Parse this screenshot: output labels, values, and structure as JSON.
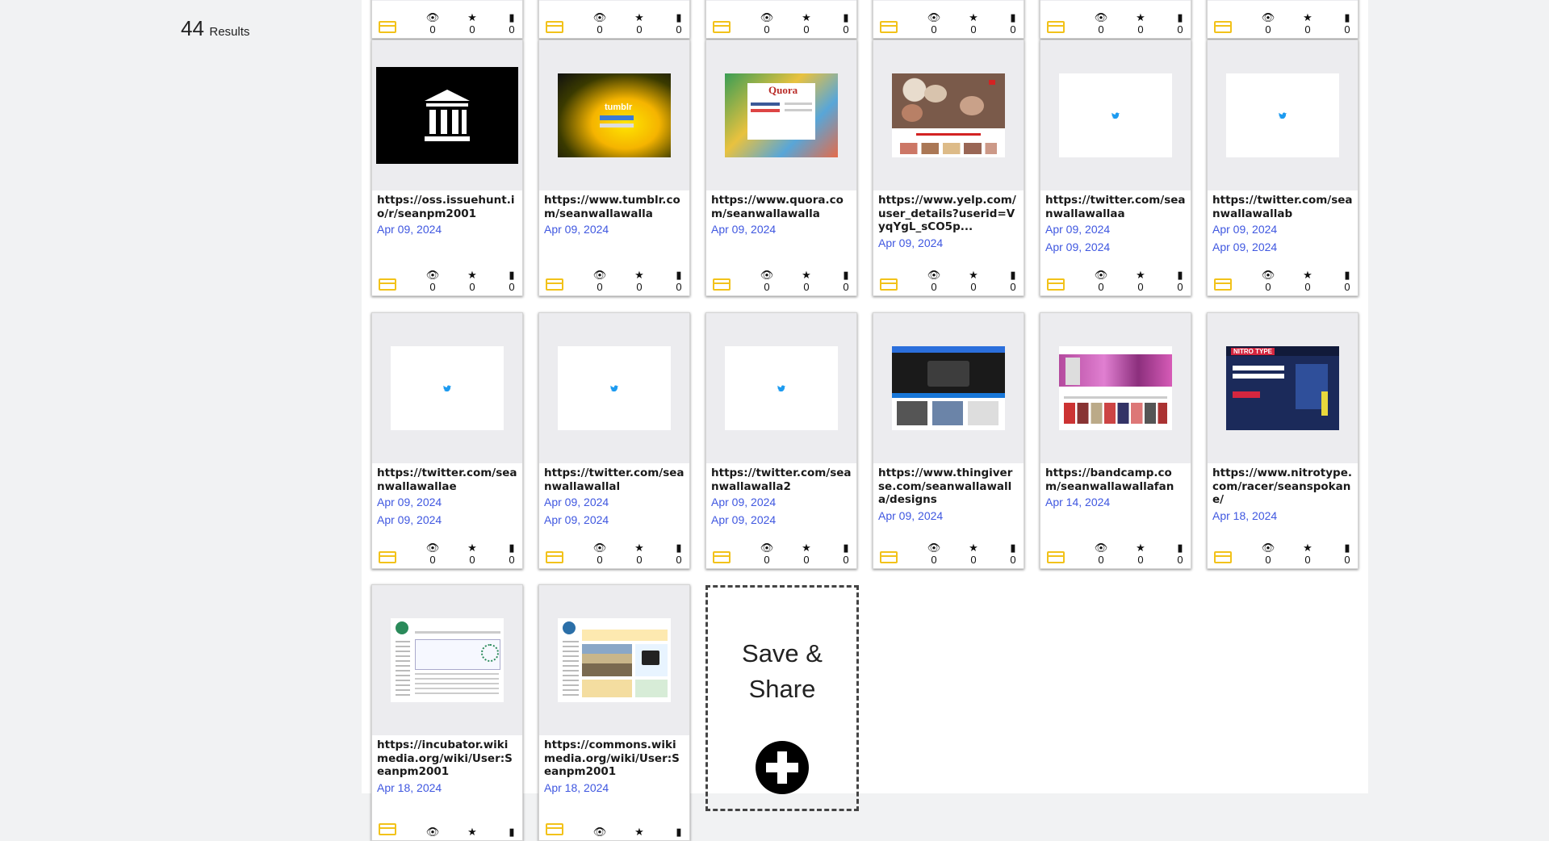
{
  "results": {
    "count": "44",
    "label": "Results"
  },
  "cards": [
    {
      "url": "",
      "dates": [],
      "views": "0",
      "stars": "0",
      "comments": "0",
      "thumb": "none"
    },
    {
      "url": "",
      "dates": [],
      "views": "0",
      "stars": "0",
      "comments": "0",
      "thumb": "none"
    },
    {
      "url": "",
      "dates": [],
      "views": "0",
      "stars": "0",
      "comments": "0",
      "thumb": "none"
    },
    {
      "url": "",
      "dates": [],
      "views": "0",
      "stars": "0",
      "comments": "0",
      "thumb": "none"
    },
    {
      "url": "",
      "dates": [],
      "views": "0",
      "stars": "0",
      "comments": "0",
      "thumb": "none"
    },
    {
      "url": "",
      "dates": [],
      "views": "0",
      "stars": "0",
      "comments": "0",
      "thumb": "none"
    },
    {
      "url": "https://oss.issuehunt.io/r/seanpm2001",
      "dates": [
        "Apr 09, 2024"
      ],
      "views": "0",
      "stars": "0",
      "comments": "0",
      "thumb": "archive"
    },
    {
      "url": "https://www.tumblr.com/seanwallawalla",
      "dates": [
        "Apr 09, 2024"
      ],
      "views": "0",
      "stars": "0",
      "comments": "0",
      "thumb": "tumblr"
    },
    {
      "url": "https://www.quora.com/seanwallawalla",
      "dates": [
        "Apr 09, 2024"
      ],
      "views": "0",
      "stars": "0",
      "comments": "0",
      "thumb": "quora"
    },
    {
      "url": "https://www.yelp.com/user_details?userid=VyqYgL_sCO5p...",
      "dates": [
        "Apr 09, 2024"
      ],
      "views": "0",
      "stars": "0",
      "comments": "0",
      "thumb": "yelp"
    },
    {
      "url": "https://twitter.com/seanwallawallaa",
      "dates": [
        "Apr 09, 2024",
        "Apr 09, 2024"
      ],
      "views": "0",
      "stars": "0",
      "comments": "0",
      "thumb": "twitter"
    },
    {
      "url": "https://twitter.com/seanwallawallab",
      "dates": [
        "Apr 09, 2024",
        "Apr 09, 2024"
      ],
      "views": "0",
      "stars": "0",
      "comments": "0",
      "thumb": "twitter"
    },
    {
      "url": "https://twitter.com/seanwallawallae",
      "dates": [
        "Apr 09, 2024",
        "Apr 09, 2024"
      ],
      "views": "0",
      "stars": "0",
      "comments": "0",
      "thumb": "twitter"
    },
    {
      "url": "https://twitter.com/seanwallawallal",
      "dates": [
        "Apr 09, 2024",
        "Apr 09, 2024"
      ],
      "views": "0",
      "stars": "0",
      "comments": "0",
      "thumb": "twitter"
    },
    {
      "url": "https://twitter.com/seanwallawalla2",
      "dates": [
        "Apr 09, 2024",
        "Apr 09, 2024"
      ],
      "views": "0",
      "stars": "0",
      "comments": "0",
      "thumb": "twitter"
    },
    {
      "url": "https://www.thingiverse.com/seanwallawalla/designs",
      "dates": [
        "Apr 09, 2024"
      ],
      "views": "0",
      "stars": "0",
      "comments": "0",
      "thumb": "thingiverse"
    },
    {
      "url": "https://bandcamp.com/seanwallawallafan",
      "dates": [
        "Apr 14, 2024"
      ],
      "views": "0",
      "stars": "0",
      "comments": "0",
      "thumb": "bandcamp"
    },
    {
      "url": "https://www.nitrotype.com/racer/seanspokane/",
      "dates": [
        "Apr 18, 2024"
      ],
      "views": "0",
      "stars": "0",
      "comments": "0",
      "thumb": "nitrotype"
    },
    {
      "url": "https://incubator.wikimedia.org/wiki/User:Seanpm2001",
      "dates": [
        "Apr 18, 2024"
      ],
      "views": "",
      "stars": "",
      "comments": "",
      "thumb": "wiki"
    },
    {
      "url": "https://commons.wikimedia.org/wiki/User:Seanpm2001",
      "dates": [
        "Apr 18, 2024"
      ],
      "views": "",
      "stars": "",
      "comments": "",
      "thumb": "commons"
    }
  ],
  "save": {
    "line1": "Save &",
    "line2": "Share"
  },
  "icons": {
    "folder": "folder-icon",
    "views": "eye-icon",
    "stars": "star-icon",
    "comments": "comment-icon",
    "add": "plus-circle-icon"
  },
  "colors": {
    "date": "#3f57e0",
    "folder": "#f2c21a",
    "panel": "#ffffff",
    "background": "#f1f2f3"
  }
}
